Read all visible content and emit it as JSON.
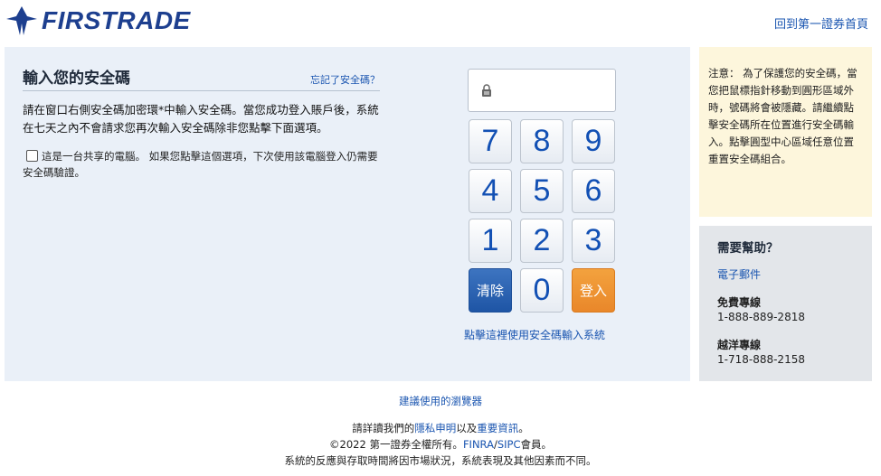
{
  "header": {
    "logo_text": "FIRSTRADE",
    "home_link": "回到第一證券首頁"
  },
  "login": {
    "title": "輸入您的安全碼",
    "forgot_link": "忘記了安全碼？",
    "instructions": "請在窗口右側安全碼加密環*中輸入安全碼。當您成功登入賬戶後，系統在七天之內不會請求您再次輸入安全碼除非您點擊下面選項。",
    "shared_computer_label": "這是一台共享的電腦。 如果您點擊這個選項，下次使用該電腦登入仍需要安全碼驗證。",
    "shared_computer_checked": false
  },
  "keypad": {
    "password_value": "",
    "keys": [
      "7",
      "8",
      "9",
      "4",
      "5",
      "6",
      "1",
      "2",
      "3"
    ],
    "clear_label": "清除",
    "zero_label": "0",
    "login_label": "登入",
    "link": "點擊這裡使用安全碼輸入系統"
  },
  "notice": {
    "text": "注意： 為了保護您的安全碼，當您把鼠標指針移動到圓形區域外時，號碼將會被隱藏。請繼續點擊安全碼所在位置進行安全碼輸入。點擊圓型中心區域任意位置重置安全碼組合。"
  },
  "help": {
    "title": "需要幫助？",
    "email_link": "電子郵件",
    "tollfree_label": "免費專線",
    "tollfree_number": "1-888-889-2818",
    "overseas_label": "越洋專線",
    "overseas_number": "1-718-888-2158"
  },
  "footer": {
    "browser_link": "建議使用的瀏覽器",
    "line1_prefix": "請詳讀我們的",
    "privacy_link": "隱私申明",
    "line1_mid": "以及",
    "important_link": "重要資訊",
    "line1_suffix": "。",
    "line2_prefix": "©2022 第一證券全權所有。",
    "finra_link": "FINRA",
    "slash": "/",
    "sipc_link": "SIPC",
    "line2_suffix": "會員。",
    "line3": "系統的反應與存取時間將因市場狀況，系統表現及其他因素而不同。"
  },
  "colors": {
    "brand": "#1d3f8f",
    "link": "#1a55b0",
    "panel": "#eaf0f8",
    "notice_bg": "#fdf6dc",
    "help_bg": "#e3e6ea",
    "clear_button": "#1e55a5",
    "login_button": "#e9872a"
  }
}
